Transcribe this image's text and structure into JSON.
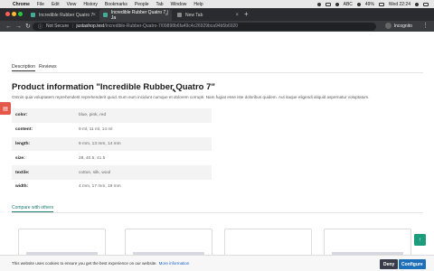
{
  "os_menubar": {
    "app": "Chrome",
    "menus": [
      "File",
      "Edit",
      "View",
      "History",
      "Bookmarks",
      "People",
      "Tab",
      "Window",
      "Help"
    ],
    "battery": "49%",
    "input": "ABC",
    "clock": "Wed 22:24"
  },
  "browser": {
    "tabs": [
      {
        "title": "Incredible Rubber Quatro 7",
        "active": false
      },
      {
        "title": "Incredible Rubber Quatro 7 | Ja",
        "active": true
      },
      {
        "title": "New Tab",
        "active": false
      }
    ],
    "new_tab_glyph": "+",
    "security_label": "Not Secure",
    "url_host": "justashop.test",
    "url_path": "/Incredible-Rubber-Quatro-7/09898b6fa49c4c26929bca94b5b6920",
    "profile_label": "Incognito"
  },
  "product": {
    "tabs": [
      "Description",
      "Reviews"
    ],
    "title": "Product information \"Incredible Rubber Quatro 7\"",
    "description": "Omnis quia voluptatem reprehenderit reprehenderit quod. Eum eum incidunt cumque et dolorem corrupti. Nam fugiat esse iste doloribus quidem. Aut itaque eligendi aliquid aspernatur voluptatum.",
    "specs": [
      {
        "key": "color:",
        "value": "blue, pink, red"
      },
      {
        "key": "content:",
        "value": "9 ml, 11 ml, 14 ml"
      },
      {
        "key": "length:",
        "value": "9 mm, 13 mm, 14 mm"
      },
      {
        "key": "size:",
        "value": "28, 40.5, 41.5"
      },
      {
        "key": "textile:",
        "value": "cotton, silk, wool"
      },
      {
        "key": "width:",
        "value": "4 mm, 17 mm, 19 mm"
      }
    ],
    "compare_label": "Compare with others"
  },
  "cookie": {
    "text": "This website uses cookies to ensure you get the best experience on our website.",
    "more_label": "More information",
    "deny_label": "Deny",
    "configure_label": "Configure"
  },
  "colors": {
    "accent": "#1b9c7d",
    "link": "#1e6fb9",
    "side_button": "#e4584a"
  }
}
